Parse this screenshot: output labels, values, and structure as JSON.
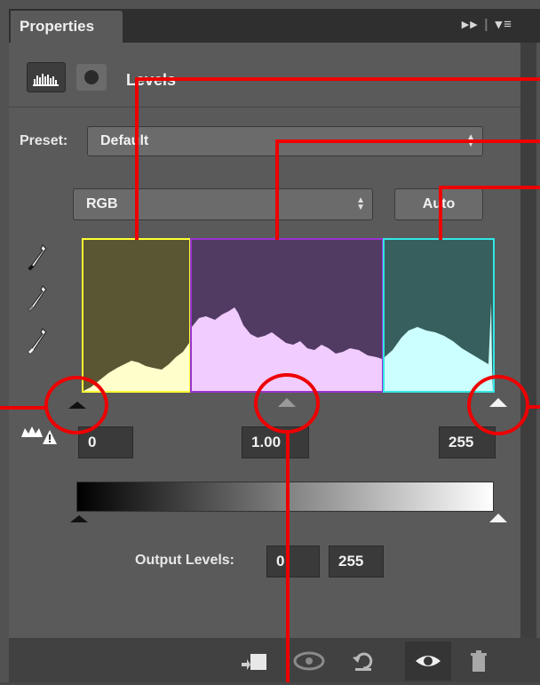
{
  "panel": {
    "tab_title": "Properties",
    "tab_icons": "▸▸ ≡",
    "adjustment_title": "Levels"
  },
  "preset": {
    "label": "Preset:",
    "value": "Default"
  },
  "channel": {
    "value": "RGB"
  },
  "auto_button": "Auto",
  "input_levels": {
    "black": "0",
    "gamma": "1.00",
    "white": "255"
  },
  "output_levels": {
    "label": "Output Levels:",
    "black": "0",
    "white": "255"
  },
  "histogram": {
    "shadows_color": "#5a5633",
    "shadows_border": "#ffff33",
    "shadows_fill": "#ffffcc",
    "midtones_color": "#523b63",
    "midtones_border": "#9933cc",
    "midtones_fill": "#f0ccff",
    "highlights_color": "#365f5d",
    "highlights_border": "#33e6e6",
    "highlights_fill": "#ccffff"
  },
  "annotation_color": "#ee0000",
  "bottom_icons": [
    "clip-to-layer-icon",
    "view-previous-icon",
    "reset-icon",
    "visibility-eye-icon",
    "trash-icon"
  ]
}
